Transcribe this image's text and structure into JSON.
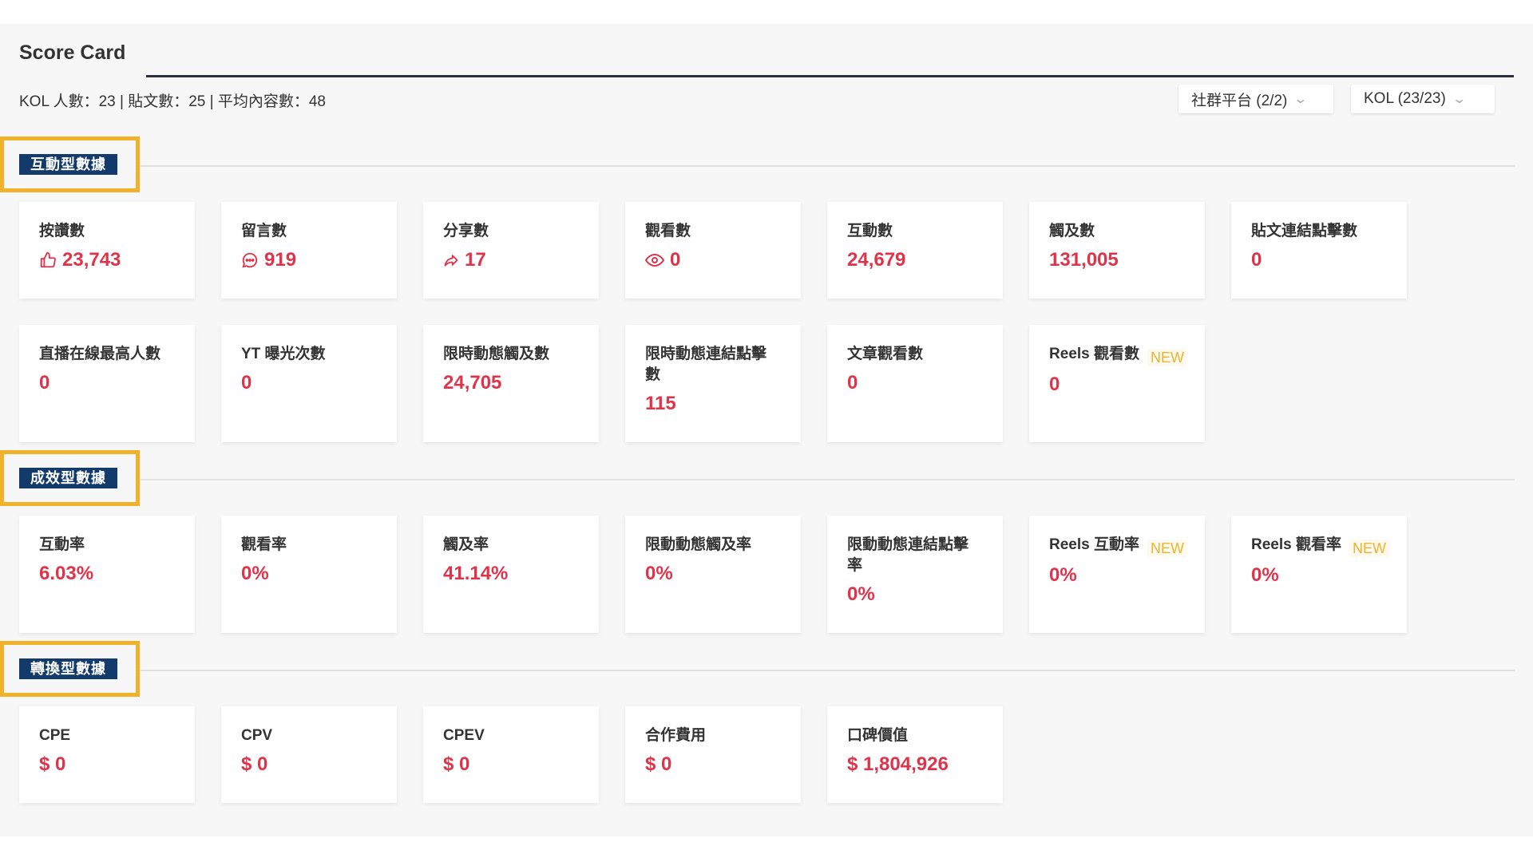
{
  "header": {
    "title": "Score Card",
    "stats": "KOL 人數：23 | 貼文數：25 | 平均內容數：48"
  },
  "filters": [
    {
      "label": "社群平台 (2/2)"
    },
    {
      "label": "KOL (23/23)"
    }
  ],
  "sections": [
    {
      "tag": "互動型數據",
      "cards": [
        {
          "label": "按讚數",
          "value": "23,743",
          "icon": "thumbs-up-icon"
        },
        {
          "label": "留言數",
          "value": "919",
          "icon": "comment-icon"
        },
        {
          "label": "分享數",
          "value": "17",
          "icon": "share-icon"
        },
        {
          "label": "觀看數",
          "value": "0",
          "icon": "eye-icon"
        },
        {
          "label": "互動數",
          "value": "24,679"
        },
        {
          "label": "觸及數",
          "value": "131,005"
        },
        {
          "label": "貼文連結點擊數",
          "value": "0"
        },
        {
          "label": "直播在線最高人數",
          "value": "0"
        },
        {
          "label": "YT 曝光次數",
          "value": "0"
        },
        {
          "label": "限時動態觸及數",
          "value": "24,705"
        },
        {
          "label": "限時動態連結點擊數",
          "value": "115"
        },
        {
          "label": "文章觀看數",
          "value": "0"
        },
        {
          "label": "Reels 觀看數",
          "value": "0",
          "badge": "NEW"
        }
      ]
    },
    {
      "tag": "成效型數據",
      "cards": [
        {
          "label": "互動率",
          "value": "6.03%"
        },
        {
          "label": "觀看率",
          "value": "0%"
        },
        {
          "label": "觸及率",
          "value": "41.14%"
        },
        {
          "label": "限動動態觸及率",
          "value": "0%"
        },
        {
          "label": "限動動態連結點擊率",
          "value": "0%"
        },
        {
          "label": "Reels 互動率",
          "value": "0%",
          "badge": "NEW"
        },
        {
          "label": "Reels 觀看率",
          "value": "0%",
          "badge": "NEW"
        }
      ]
    },
    {
      "tag": "轉換型數據",
      "cards": [
        {
          "label": "CPE",
          "value": "$ 0"
        },
        {
          "label": "CPV",
          "value": "$ 0"
        },
        {
          "label": "CPEV",
          "value": "$ 0"
        },
        {
          "label": "合作費用",
          "value": "$ 0"
        },
        {
          "label": "口碑價值",
          "value": "$ 1,804,926"
        }
      ]
    }
  ],
  "colors": {
    "accent_value": "#e0334a",
    "section_tag_bg": "#123a6b",
    "highlight_frame": "#f0b22a",
    "new_badge": "#f0b22a"
  }
}
